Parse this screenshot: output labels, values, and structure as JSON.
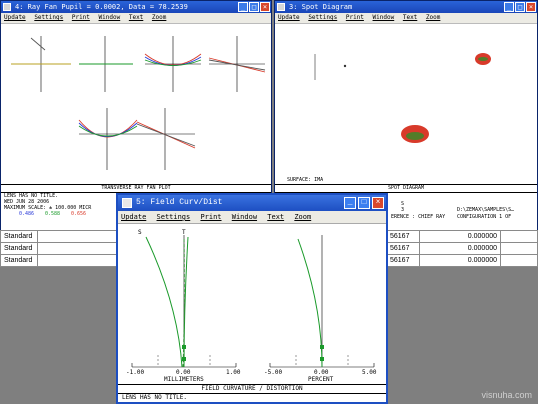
{
  "ray_fan_window": {
    "title": "4: Ray Fan Pupil = 0.0002, Data = 78.2539",
    "menu": [
      "Update",
      "Settings",
      "Print",
      "Window",
      "Text",
      "Zoom"
    ],
    "plot_title": "TRANSVERSE RAY FAN PLOT",
    "footer_lines": [
      "LENS HAS NO TITLE.",
      "WED JUN 28 2006",
      "MAXIMUM SCALE: ± 100.000 MICR"
    ],
    "wavelengths": [
      "0.486",
      "0.588",
      "0.656"
    ],
    "wavelength_colors": [
      "#2a3ad8",
      "#1a9a2a",
      "#d83a2a"
    ]
  },
  "spot_window": {
    "title": "3: Spot Diagram",
    "menu": [
      "Update",
      "Settings",
      "Print",
      "Window",
      "Text",
      "Zoom"
    ],
    "plot_title": "SPOT DIAGRAM",
    "footer_lines": [
      "SURFACE: IMA"
    ],
    "right_footer": [
      "D:\\ZEMAX\\SAMPLES\\S…",
      "CONFIGURATION 1 OF"
    ],
    "mid_footer": [
      "S",
      "3",
      "ERENCE : CHIEF RAY"
    ]
  },
  "spreadsheet": {
    "rows": [
      {
        "type": "Standard",
        "col_a": "56167",
        "col_b": "0.000000"
      },
      {
        "type": "Standard",
        "col_a": "56167",
        "col_b": "0.000000"
      },
      {
        "type": "Standard",
        "col_a": "56167",
        "col_b": "0.000000"
      }
    ]
  },
  "field_curv_window": {
    "title": "5: Field Curv/Dist",
    "menu": [
      "Update",
      "Settings",
      "Print",
      "Window",
      "Text",
      "Zoom"
    ],
    "legend_s": "S",
    "legend_t": "T",
    "left_ticks": [
      "-1.00",
      "0.00",
      "1.00"
    ],
    "left_unit": "MILLIMETERS",
    "right_ticks": [
      "-5.00",
      "0.00",
      "5.00"
    ],
    "right_unit": "PERCENT",
    "plot_title": "FIELD CURVATURE / DISTORTION",
    "footer": "LENS HAS NO TITLE."
  },
  "watermark": "visnuha.com"
}
